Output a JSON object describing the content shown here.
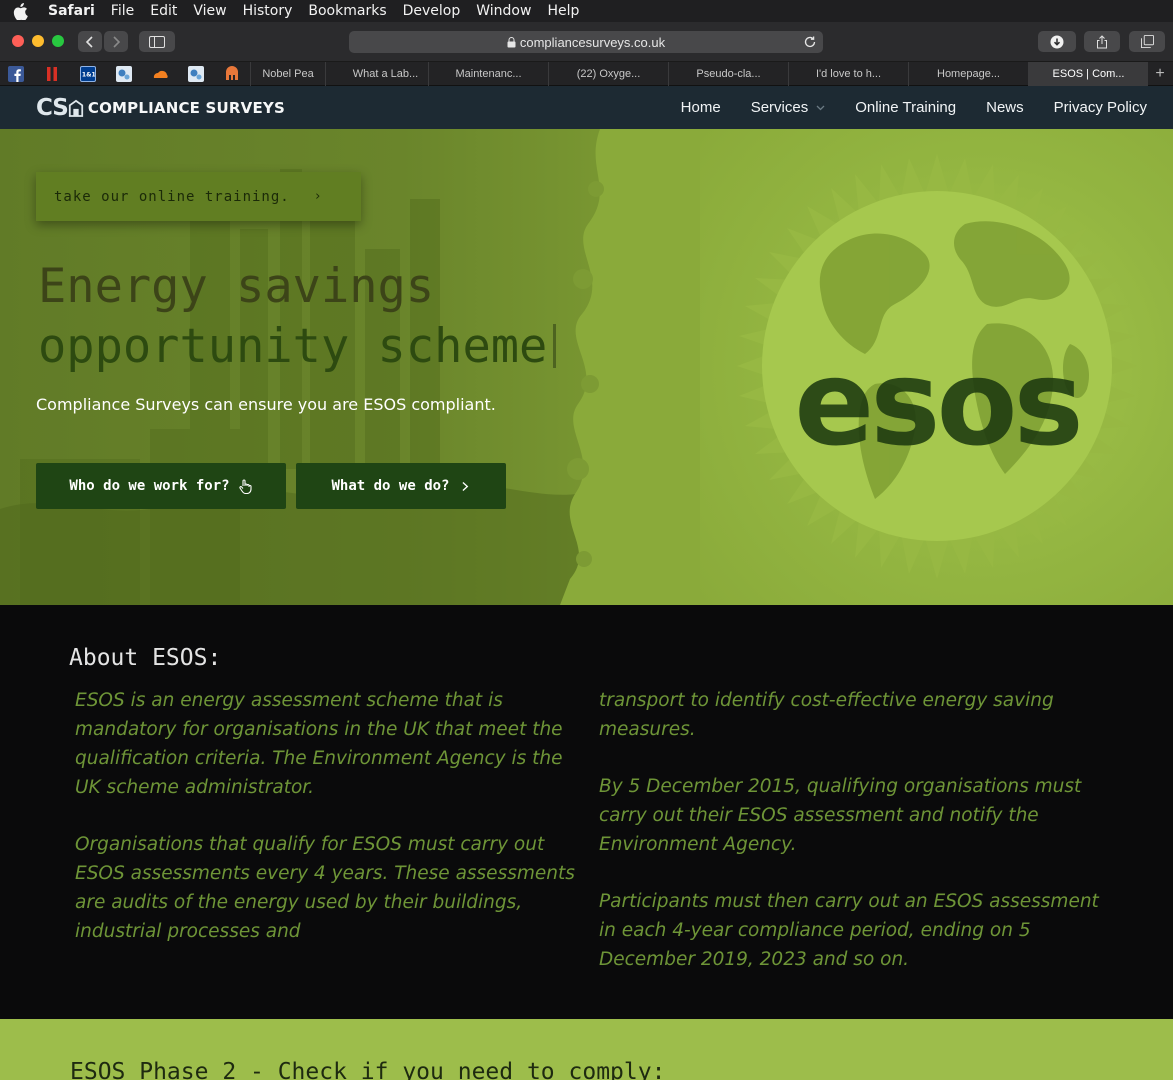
{
  "menubar": {
    "app": "Safari",
    "items": [
      "File",
      "Edit",
      "View",
      "History",
      "Bookmarks",
      "Develop",
      "Window",
      "Help"
    ]
  },
  "browser": {
    "url": "compliancesurveys.co.uk"
  },
  "tabs": [
    {
      "label": "Nobel Pea"
    },
    {
      "label": "What a Lab..."
    },
    {
      "label": "Maintenanc..."
    },
    {
      "label": "(22) Oxyge..."
    },
    {
      "label": "Pseudo-cla..."
    },
    {
      "label": "I'd love to h..."
    },
    {
      "label": "Homepage..."
    },
    {
      "label": "ESOS | Com..."
    }
  ],
  "site": {
    "logo_mark": "CS",
    "logo_text": "COMPLIANCE SURVEYS",
    "nav": [
      {
        "label": "Home"
      },
      {
        "label": "Services"
      },
      {
        "label": "Online Training"
      },
      {
        "label": "News"
      },
      {
        "label": "Privacy Policy"
      }
    ]
  },
  "hero": {
    "training_button": "take our online training.",
    "title_part1": "Energy savings",
    "title_part2": "opportunity scheme",
    "subtitle": "Compliance Surveys can ensure you are ESOS compliant.",
    "cta_primary": "Who do we work for?",
    "cta_secondary": "What do we do?",
    "globe_text": "esos"
  },
  "about": {
    "title": "About ESOS:",
    "paragraphs_col1": [
      "ESOS is an energy assessment scheme that is mandatory for organisations in the UK that meet the qualification criteria. The Environment Agency is the UK scheme administrator.",
      "Organisations that qualify for ESOS must carry out ESOS assessments every 4 years. These assessments are audits of the energy used by their buildings, industrial processes and"
    ],
    "paragraphs_col2": [
      "transport to identify cost-effective energy saving measures.",
      "By 5 December 2015, qualifying organisations must carry out their ESOS assessment and notify the Environment Agency.",
      "Participants must then carry out an ESOS assessment in each 4-year compliance period, ending on 5 December 2019, 2023 and so on."
    ]
  },
  "phase2": {
    "title": "ESOS Phase 2 - Check if you need to comply:"
  },
  "colors": {
    "hero_green": "#8aaa3a",
    "dark_green": "#1f4514",
    "header_navy": "#1d2a33",
    "about_text": "#6e9537"
  }
}
